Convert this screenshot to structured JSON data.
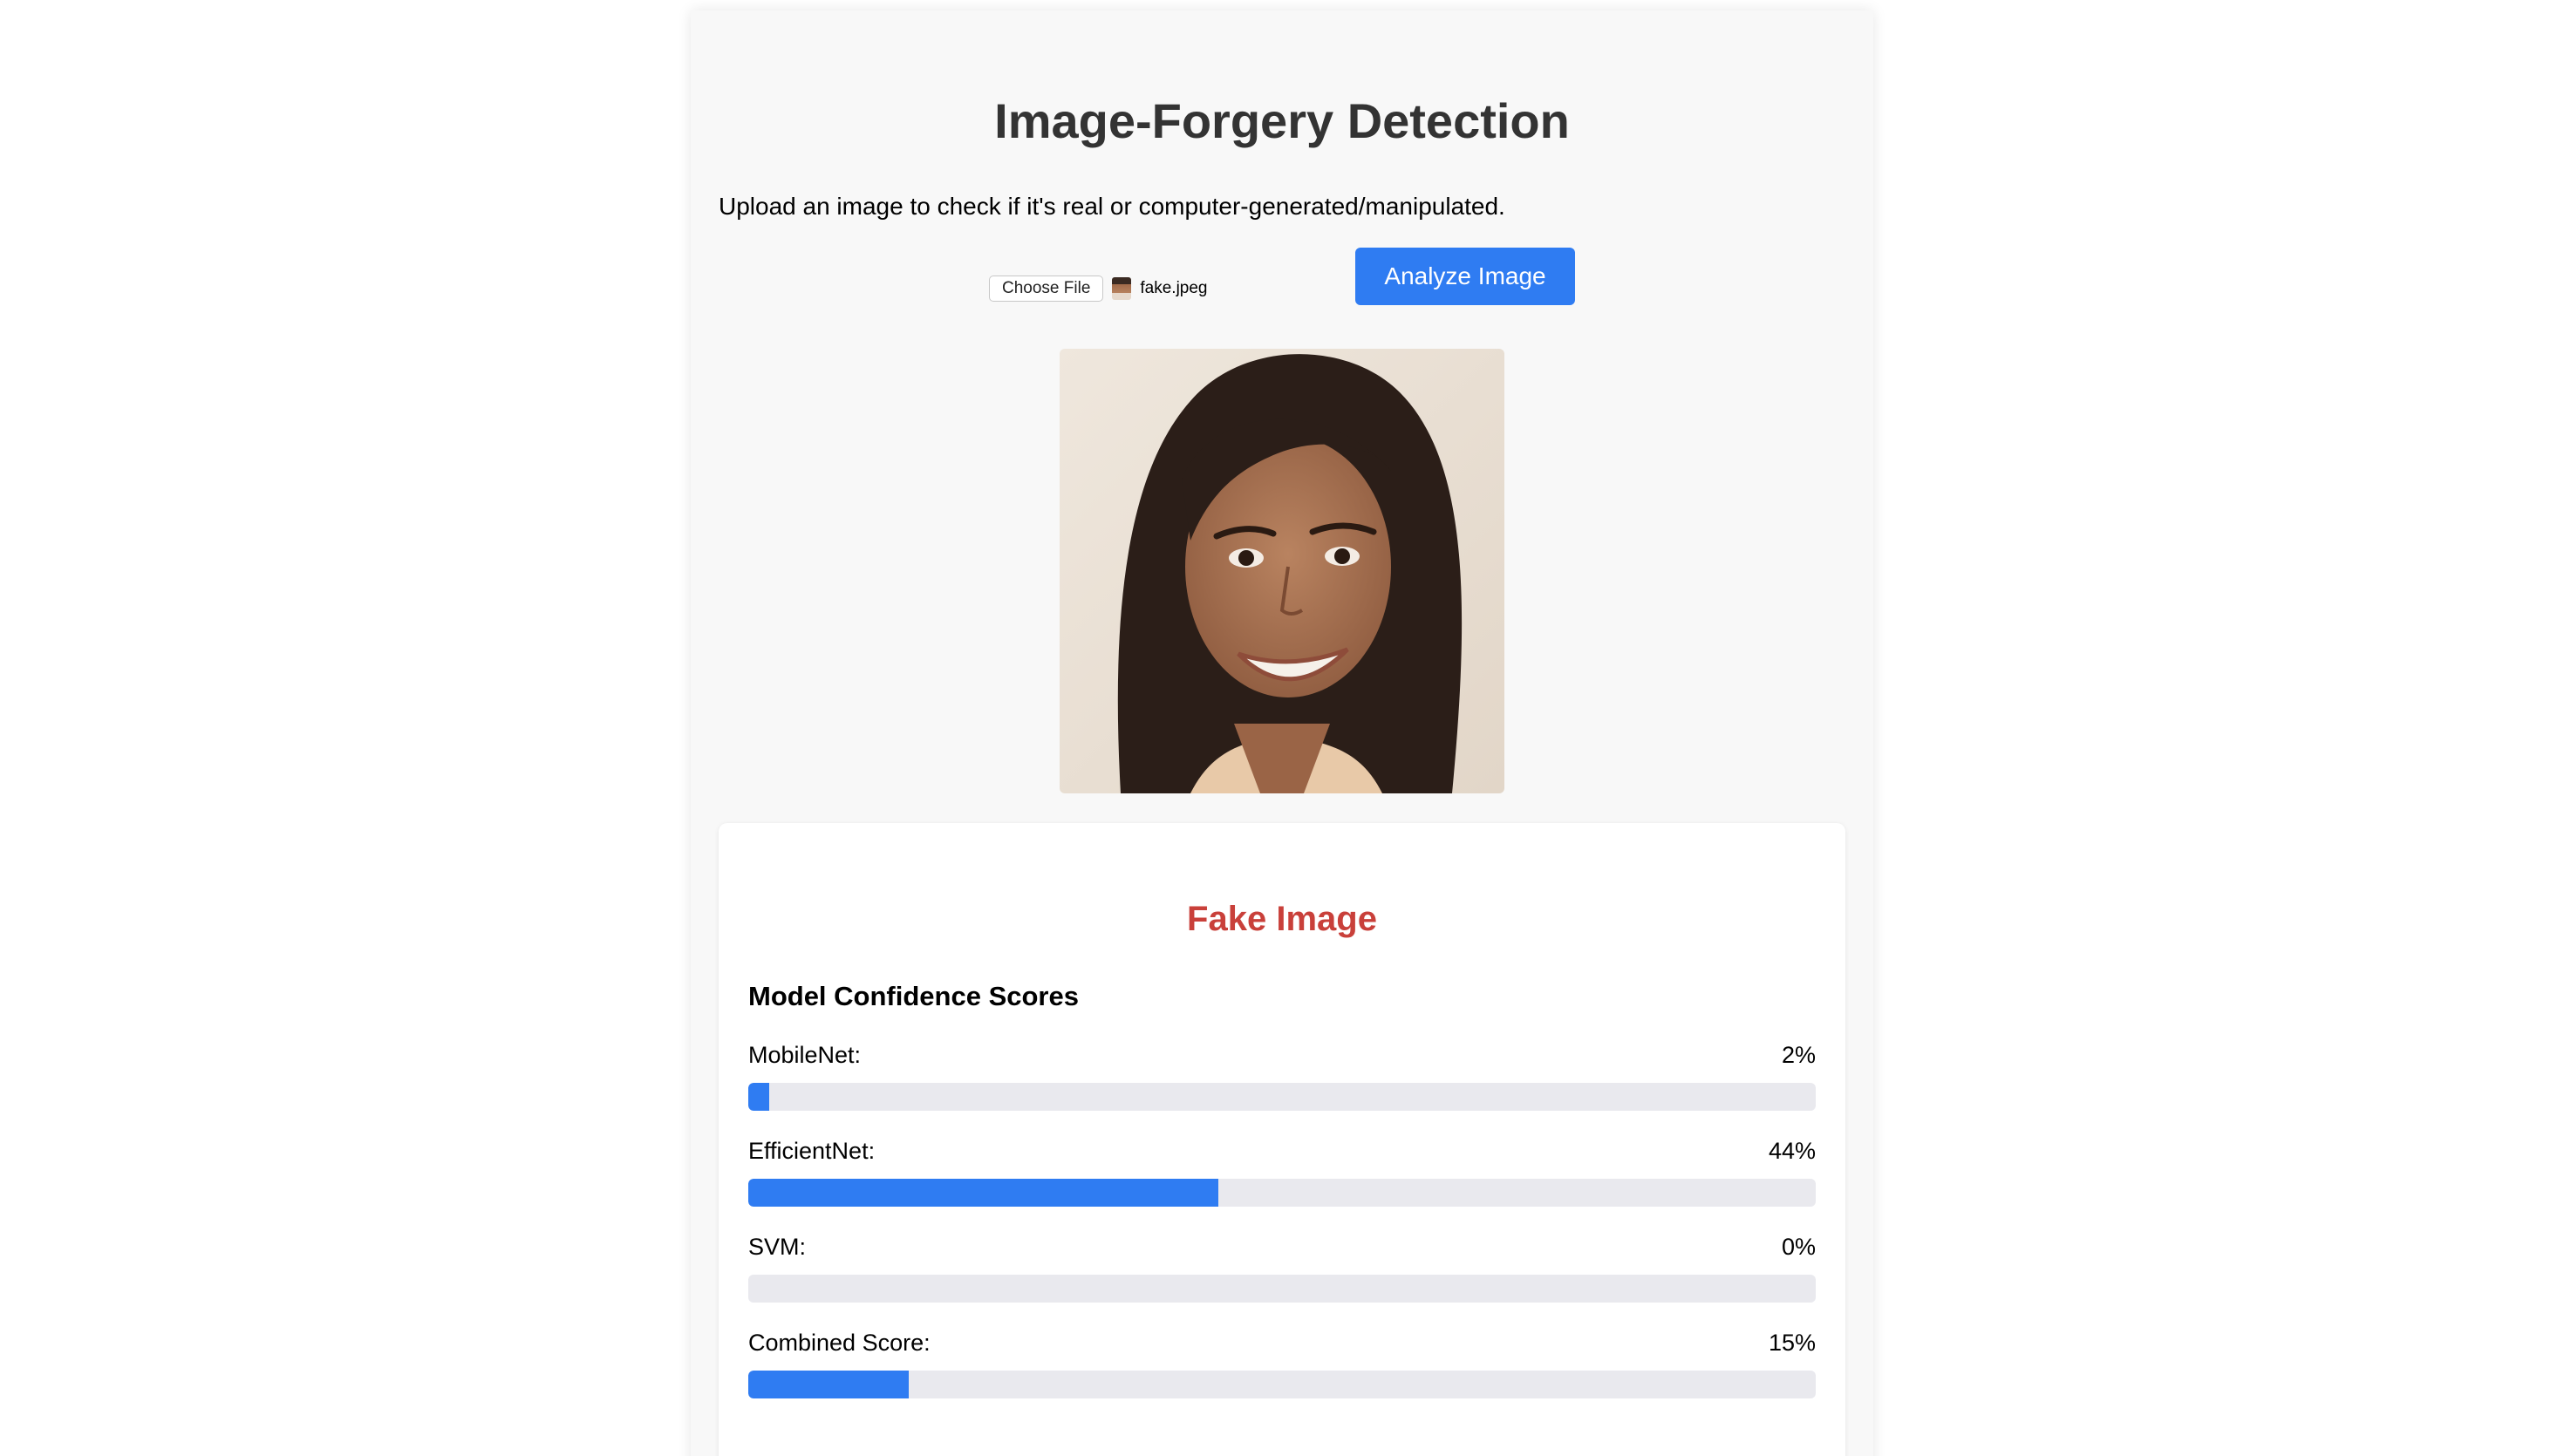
{
  "header": {
    "title": "Image-Forgery Detection",
    "description": "Upload an image to check if it's real or computer-generated/manipulated."
  },
  "upload": {
    "choose_file_label": "Choose File",
    "file_name": "fake.jpeg",
    "analyze_label": "Analyze Image"
  },
  "preview": {
    "subject": "portrait photo of smiling woman with long dark hair"
  },
  "result": {
    "verdict": "Fake Image",
    "verdict_color": "#c9403a",
    "scores_heading": "Model Confidence Scores",
    "bar_color": "#2f7cf2",
    "track_color": "#e9e9ee",
    "scores": [
      {
        "label": "MobileNet:",
        "value_text": "2%",
        "value": 2
      },
      {
        "label": "EfficientNet:",
        "value_text": "44%",
        "value": 44
      },
      {
        "label": "SVM:",
        "value_text": "0%",
        "value": 0
      },
      {
        "label": "Combined Score:",
        "value_text": "15%",
        "value": 15
      }
    ]
  }
}
